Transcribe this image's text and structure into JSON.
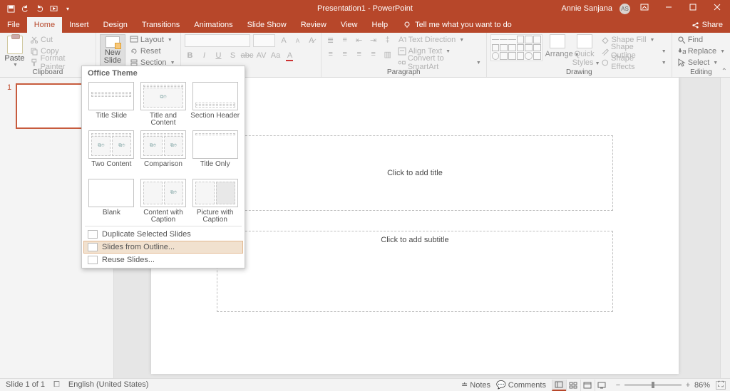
{
  "titlebar": {
    "title": "Presentation1 - PowerPoint",
    "user": "Annie Sanjana",
    "initials": "AS"
  },
  "tabs": {
    "file": "File",
    "home": "Home",
    "insert": "Insert",
    "design": "Design",
    "transitions": "Transitions",
    "animations": "Animations",
    "slideshow": "Slide Show",
    "review": "Review",
    "view": "View",
    "help": "Help",
    "tellme": "Tell me what you want to do",
    "share": "Share"
  },
  "ribbon": {
    "clipboard": {
      "paste": "Paste",
      "cut": "Cut",
      "copy": "Copy",
      "fmt": "Format Painter",
      "label": "Clipboard"
    },
    "slides": {
      "newslide1": "New",
      "newslide2": "Slide",
      "layout": "Layout",
      "reset": "Reset",
      "section": "Section"
    },
    "font": {
      "bold": "B",
      "italic": "I",
      "underline": "U",
      "strike": "S",
      "shadow": "abc",
      "spacing": "AV",
      "case": "Aa"
    },
    "paragraph": {
      "label": "Paragraph",
      "dir": "Text Direction",
      "align": "Align Text",
      "smart": "Convert to SmartArt"
    },
    "drawing": {
      "label": "Drawing",
      "arrange": "Arrange",
      "quick": "Quick Styles",
      "fill": "Shape Fill",
      "outline": "Shape Outline",
      "effects": "Shape Effects"
    },
    "editing": {
      "label": "Editing",
      "find": "Find",
      "replace": "Replace",
      "select": "Select"
    }
  },
  "dropdown": {
    "header": "Office Theme",
    "layouts": [
      "Title Slide",
      "Title and Content",
      "Section Header",
      "Two Content",
      "Comparison",
      "Title Only",
      "Blank",
      "Content with Caption",
      "Picture with Caption"
    ],
    "dup": "Duplicate Selected Slides",
    "outline": "Slides from Outline...",
    "reuse": "Reuse Slides..."
  },
  "canvas": {
    "title": "Click to add title",
    "subtitle": "Click to add subtitle"
  },
  "status": {
    "slideof": "Slide 1 of 1",
    "lang": "English (United States)",
    "notes": "Notes",
    "comments": "Comments",
    "zoom": "86%"
  },
  "thumb": {
    "n1": "1"
  }
}
